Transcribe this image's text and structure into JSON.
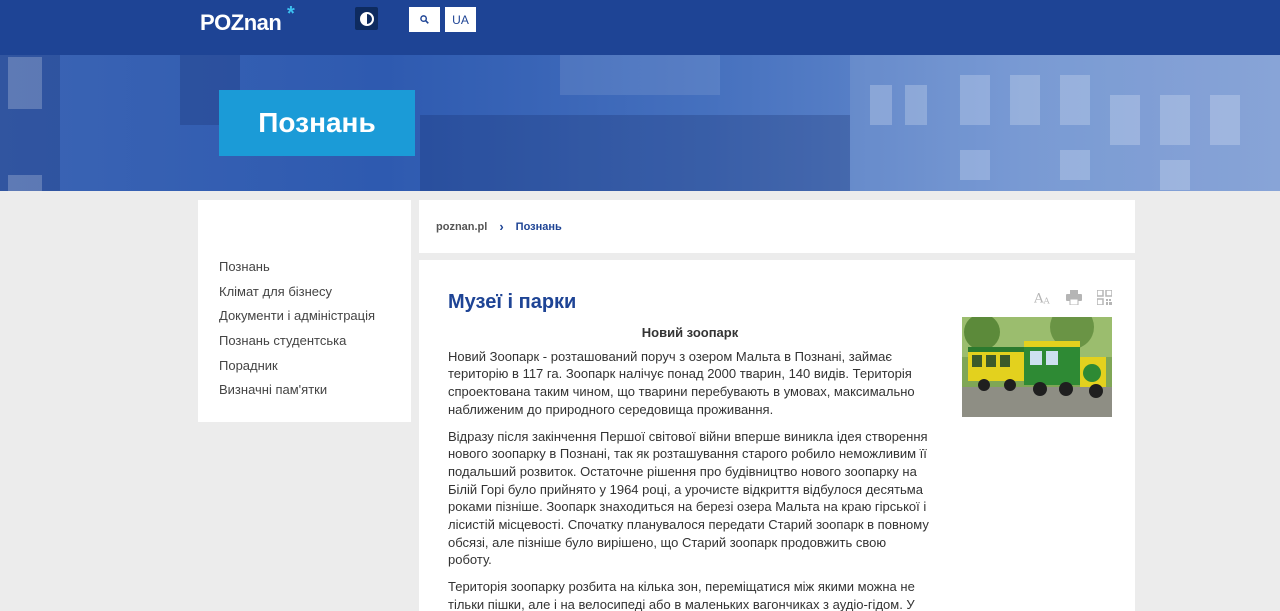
{
  "header": {
    "logo_text": "POZnan",
    "logo_mark": "*",
    "search_icon": "search-icon",
    "contrast_icon": "contrast-icon",
    "lang_label": "UA"
  },
  "hero": {
    "title": "Познань"
  },
  "sidebar": {
    "items": [
      {
        "label": "Познань"
      },
      {
        "label": "Клімат для бізнесу"
      },
      {
        "label": "Документи і адміністрація"
      },
      {
        "label": "Познань студентська"
      },
      {
        "label": "Порадник"
      },
      {
        "label": "Визначні пам'ятки"
      }
    ]
  },
  "breadcrumb": {
    "home": "poznan.pl",
    "separator": "›",
    "current": "Познань"
  },
  "article": {
    "title": "Музеї і парки",
    "subtitle": "Новий зоопарк",
    "paragraphs": [
      "Новий Зоопарк - розташований поруч з озером Мальта в Познані, займає територію в 117 га. Зоопарк налічує понад 2000 тварин, 140 видів. Територія спроектована таким чином, що тварини перебувають в умовах, максимально наближеним до природного середовища проживання.",
      "Відразу після закінчення Першої світової війни вперше виникла ідея створення нового зоопарку в Познані, так як розташування старого робило неможливим її подальший розвиток. Остаточне рішення про будівництво нового зоопарку на Білій Горі було прийнято у 1964 році, а урочисте відкриття відбулося десятьма роками пізніше. Зоопарк знаходиться на березі озера Мальта на краю гірської і лісистій місцевості. Спочатку планувалося передати Старий зоопарк в повному обсязі, але пізніше було вирішено, що Старий зоопарк продовжить свою роботу.",
      "Територія зоопарку розбита на кілька зон, переміщатися між якими можна не тільки пішки, але і на велосипеді або в маленьких вагончиках з аудіо-гідом. У"
    ],
    "tools": [
      "font-size-icon",
      "print-icon",
      "qr-code-icon"
    ],
    "image_icon": "zoo-train-photo"
  },
  "colors": {
    "brand_blue": "#1e4495",
    "accent_cyan": "#1b9bd7",
    "background": "#ececec"
  }
}
